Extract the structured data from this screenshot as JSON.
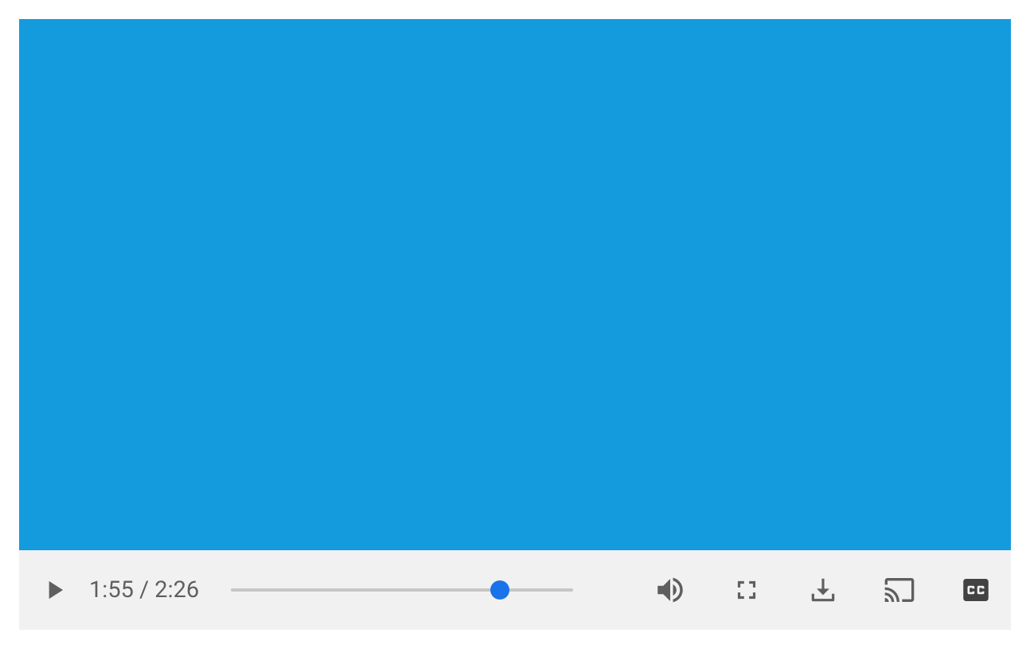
{
  "player": {
    "video_background": "#149bde",
    "controls_background": "#f1f1f1",
    "icon_color": "#5f5f5f",
    "accent_color": "#1a73e8",
    "current_time": "1:55",
    "time_separator": " / ",
    "total_time": "2:26",
    "progress_percent": 78.7,
    "icons": {
      "play": "play-icon",
      "volume": "volume-icon",
      "fullscreen": "fullscreen-icon",
      "download": "download-icon",
      "cast": "cast-icon",
      "captions": "captions-icon"
    }
  }
}
